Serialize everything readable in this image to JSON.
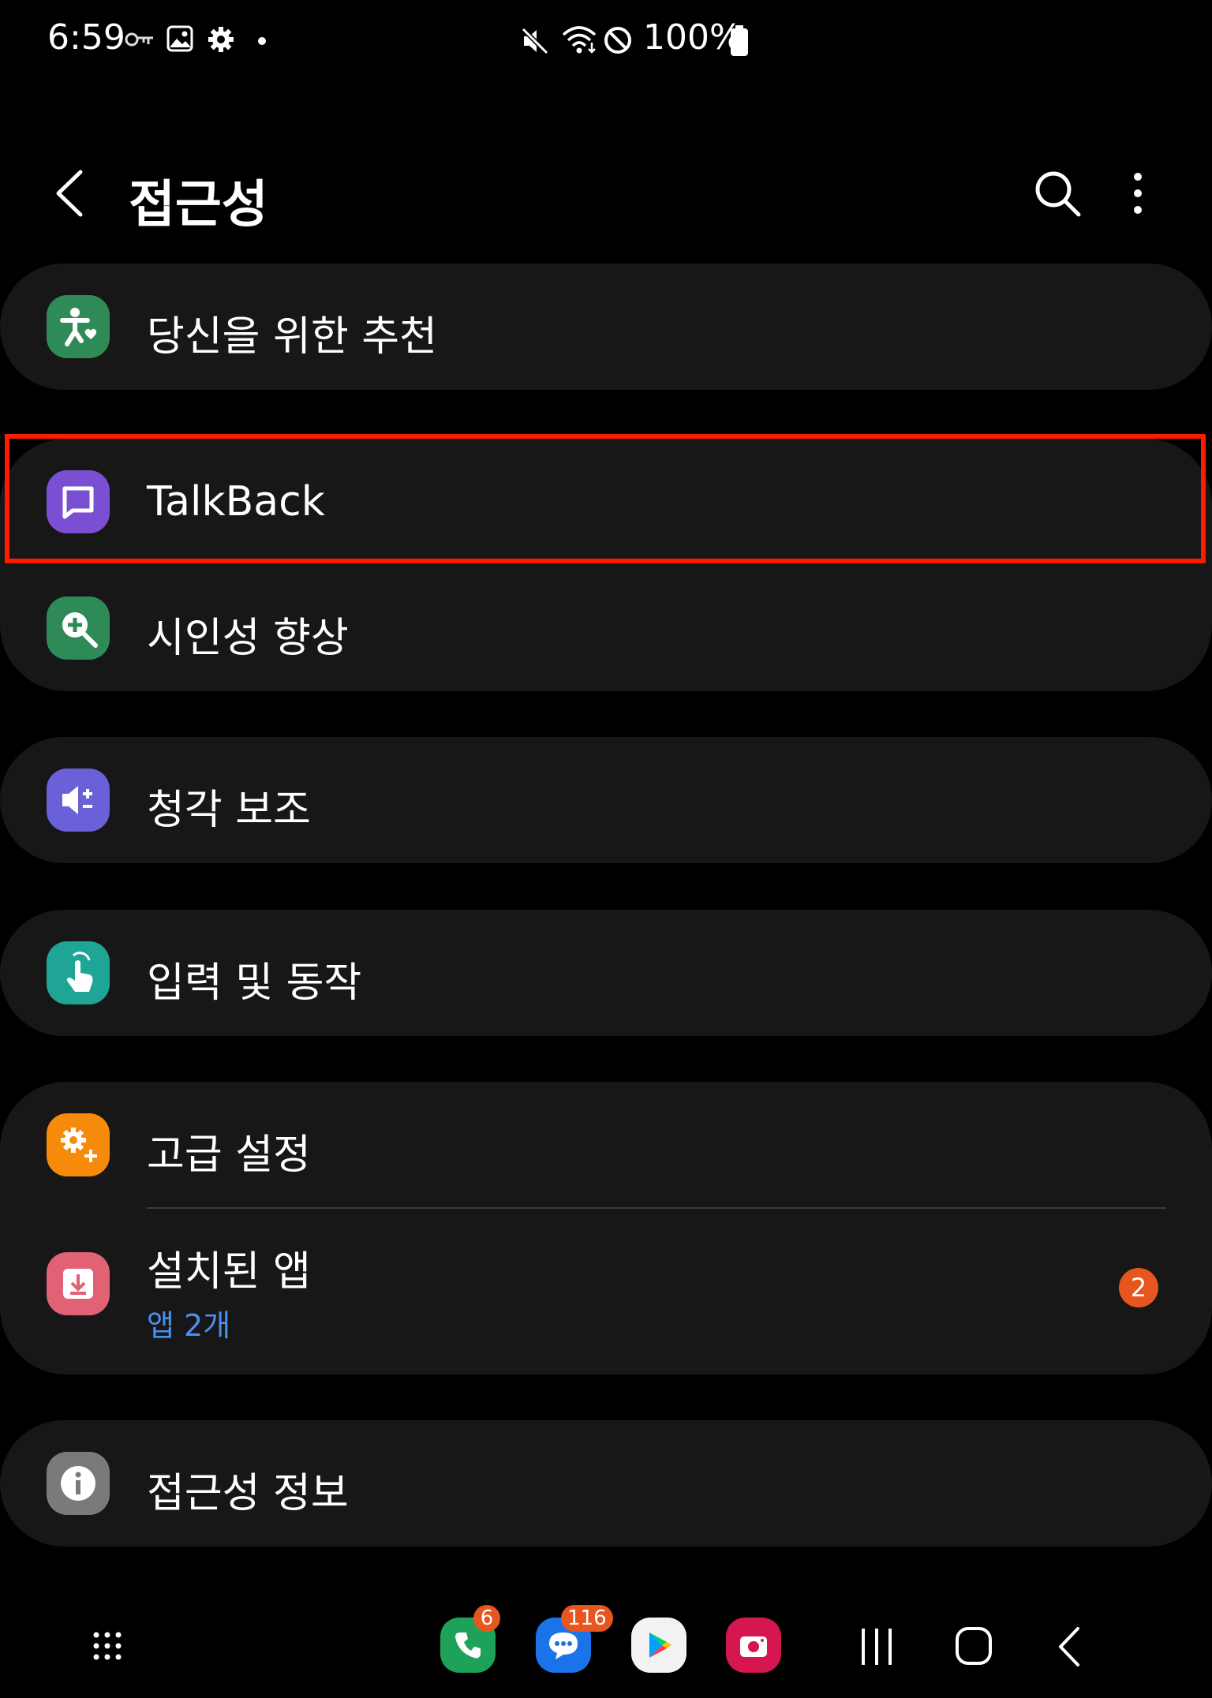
{
  "status_bar": {
    "time": "6:59",
    "battery_text": "100%",
    "icons": [
      "vpn-key-icon",
      "gallery-icon",
      "settings-icon",
      "dot-icon",
      "mute-icon",
      "wifi-icon",
      "do-not-disturb-icon",
      "battery-icon"
    ]
  },
  "header": {
    "title": "접근성",
    "icons": [
      "back-arrow-icon",
      "search-icon",
      "more-vertical-icon"
    ]
  },
  "menu": {
    "recommended": {
      "label": "당신을 위한 추천",
      "icon": "accessibility-heart-icon",
      "icon_color": "#2e8b57"
    },
    "talkback": {
      "label": "TalkBack",
      "icon": "chat-bubble-icon",
      "icon_color": "#7b4fd1"
    },
    "visibility": {
      "label": "시인성 향상",
      "icon": "zoom-in-icon",
      "icon_color": "#2e8b57"
    },
    "hearing": {
      "label": "청각 보조",
      "icon": "volume-plus-minus-icon",
      "icon_color": "#6a60d8"
    },
    "interaction": {
      "label": "입력 및 동작",
      "icon": "touch-hand-icon",
      "icon_color": "#1fa596"
    },
    "advanced": {
      "label": "고급 설정",
      "icon": "gear-plus-icon",
      "icon_color": "#f58a0b"
    },
    "installed": {
      "label": "설치된 앱",
      "sub": "앱 2개",
      "badge": "2",
      "icon": "download-icon",
      "icon_color": "#e16275"
    },
    "about": {
      "label": "접근성 정보",
      "icon": "info-icon",
      "icon_color": "#7a7a7a"
    }
  },
  "nav_bar": {
    "apps": [
      {
        "name": "phone",
        "badge": "6",
        "color": "#1ea25a"
      },
      {
        "name": "messages",
        "badge": "116",
        "color": "#1a73e8"
      },
      {
        "name": "play-store",
        "badge": "",
        "color": "#f2f2f2"
      },
      {
        "name": "camera",
        "badge": "",
        "color": "#d6164f"
      }
    ],
    "buttons": [
      "app-drawer-icon",
      "recents-icon",
      "home-icon",
      "back-icon"
    ]
  }
}
